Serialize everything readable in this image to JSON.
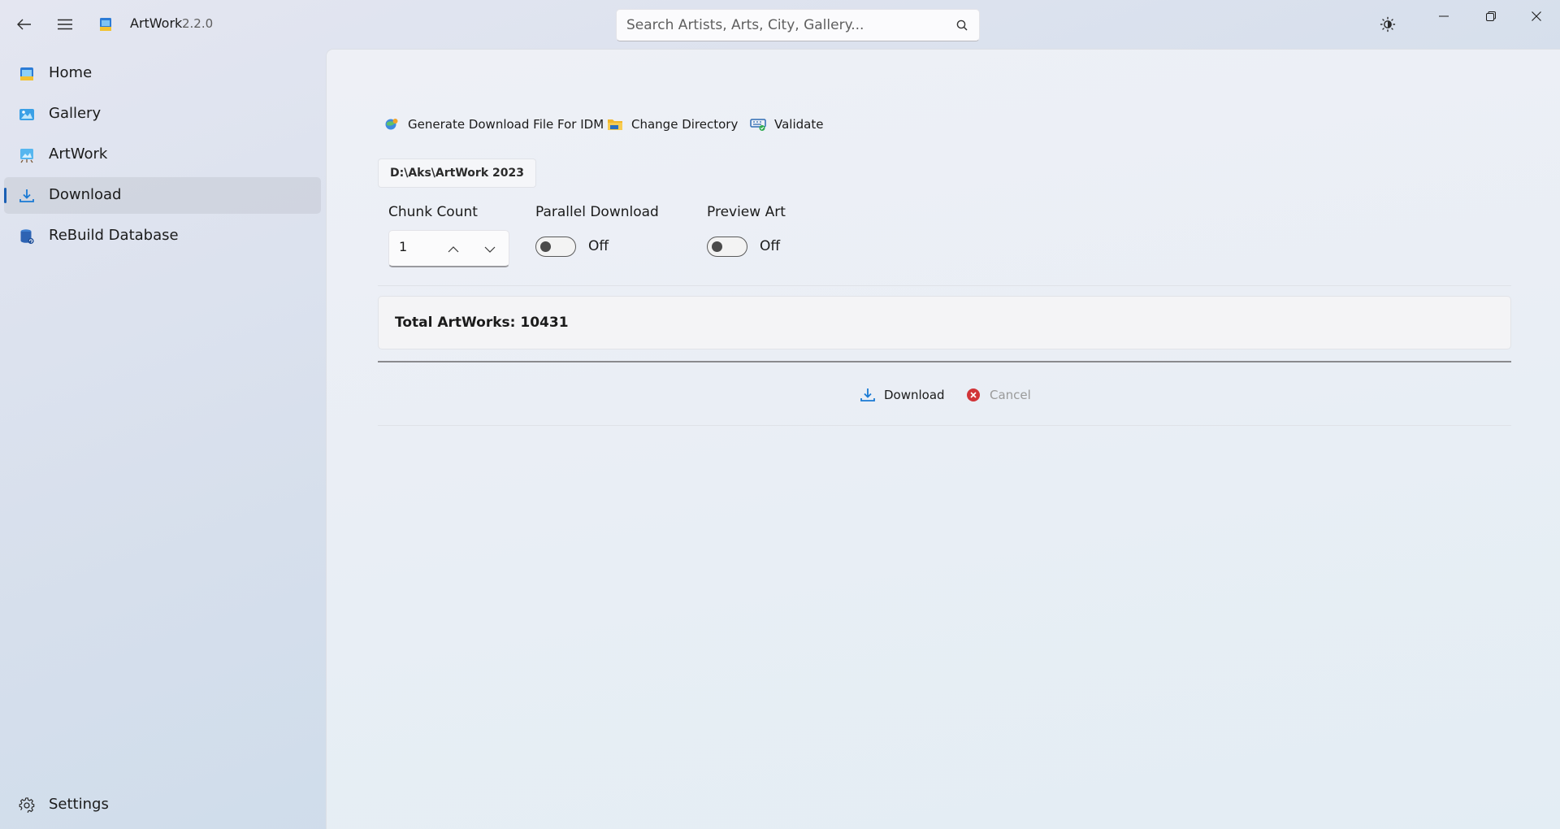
{
  "app": {
    "title": "ArtWork",
    "version": "2.2.0"
  },
  "search": {
    "placeholder": "Search Artists, Arts, City, Gallery..."
  },
  "sidebar": {
    "items": [
      {
        "label": "Home",
        "icon": "home-icon"
      },
      {
        "label": "Gallery",
        "icon": "gallery-icon"
      },
      {
        "label": "ArtWork",
        "icon": "artwork-icon"
      },
      {
        "label": "Download",
        "icon": "download-icon",
        "active": true
      },
      {
        "label": "ReBuild Database",
        "icon": "database-icon"
      }
    ],
    "settings_label": "Settings"
  },
  "toolbar": {
    "generate_label": "Generate Download File For IDM",
    "change_dir_label": "Change Directory",
    "validate_label": "Validate"
  },
  "directory": "D:\\Aks\\ArtWork 2023",
  "options": {
    "chunk_count_label": "Chunk Count",
    "chunk_count_value": "1",
    "parallel_label": "Parallel Download",
    "parallel_state": "Off",
    "preview_label": "Preview Art",
    "preview_state": "Off"
  },
  "summary": {
    "total_text": "Total ArtWorks: 10431"
  },
  "actions": {
    "download_label": "Download",
    "cancel_label": "Cancel"
  },
  "colors": {
    "accent": "#1a5fb4",
    "cancel_red": "#d13438",
    "disabled_text": "#9a9a9a"
  }
}
